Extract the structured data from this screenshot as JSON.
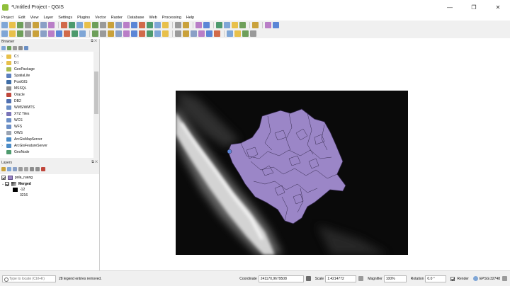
{
  "window": {
    "title": "*Untitled Project - QGIS",
    "controls": [
      "—",
      "❐",
      "✕"
    ]
  },
  "menu": [
    "Project",
    "Edit",
    "View",
    "Layer",
    "Settings",
    "Plugins",
    "Vector",
    "Raster",
    "Database",
    "Web",
    "Processing",
    "Help"
  ],
  "toolbar_icons": {
    "row1": [
      "new-project-icon",
      "open-project-icon",
      "save-project-icon",
      "save-as-icon",
      "print-layout-icon",
      "layout-manager-icon",
      "style-manager-icon",
      "sep",
      "pan-icon",
      "pan-to-selection-icon",
      "zoom-in-icon",
      "zoom-out-icon",
      "zoom-full-icon",
      "zoom-to-selection-icon",
      "zoom-to-layer-icon",
      "zoom-native-icon",
      "zoom-last-icon",
      "zoom-next-icon",
      "new-map-view-icon",
      "new-3d-view-icon",
      "temporal-icon",
      "refresh-icon",
      "sep",
      "identify-icon",
      "action-icon",
      "sep",
      "select-icon",
      "deselect-icon",
      "sep",
      "attribute-table-icon",
      "field-calculator-icon",
      "statistics-icon",
      "sum-icon",
      "sep",
      "measure-icon",
      "sep",
      "annotation-icon",
      "text-annotation-icon"
    ],
    "row2": [
      "data-source-manager-icon",
      "new-geopackage-icon",
      "new-shapefile-icon",
      "new-spatialite-icon",
      "new-memory-layer-icon",
      "add-vector-icon",
      "add-raster-icon",
      "add-mesh-icon",
      "add-delimited-text-icon",
      "add-spatialite-icon",
      "add-postgis-icon",
      "sep",
      "current-edits-icon",
      "toggle-editing-icon",
      "save-edits-icon",
      "digitize-icon",
      "delete-icon",
      "cut-icon",
      "copy-icon",
      "paste-icon",
      "undo-icon",
      "redo-icon",
      "sep",
      "label-icon",
      "label-pin-icon",
      "label-show-icon",
      "label-move-icon",
      "label-rotate-icon",
      "label-change-icon",
      "sep",
      "python-console-icon",
      "georeferencer-icon",
      "globe-icon",
      "plugin-icon"
    ]
  },
  "browser": {
    "title": "Browser",
    "items": [
      {
        "label": "C:\\",
        "icon": "folder-icon",
        "color": "#e8c04a",
        "arrow": "›"
      },
      {
        "label": "D:\\",
        "icon": "folder-icon",
        "color": "#e8c04a",
        "arrow": "›"
      },
      {
        "label": "GeoPackage",
        "icon": "geopackage-icon",
        "color": "#a9bc4f",
        "arrow": ""
      },
      {
        "label": "SpatiaLite",
        "icon": "spatialite-icon",
        "color": "#5b7fbf",
        "arrow": ""
      },
      {
        "label": "PostGIS",
        "icon": "postgis-icon",
        "color": "#3e6da6",
        "arrow": ""
      },
      {
        "label": "MSSQL",
        "icon": "mssql-icon",
        "color": "#8e8e8e",
        "arrow": ""
      },
      {
        "label": "Oracle",
        "icon": "oracle-icon",
        "color": "#c0463b",
        "arrow": ""
      },
      {
        "label": "DB2",
        "icon": "db2-icon",
        "color": "#4f6fb0",
        "arrow": ""
      },
      {
        "label": "WMS/WMTS",
        "icon": "wms-icon",
        "color": "#6b8fc7",
        "arrow": ""
      },
      {
        "label": "XYZ Tiles",
        "icon": "xyz-tiles-icon",
        "color": "#7a74b8",
        "arrow": "›"
      },
      {
        "label": "WCS",
        "icon": "wcs-icon",
        "color": "#6b8fc7",
        "arrow": ""
      },
      {
        "label": "WFS",
        "icon": "wfs-icon",
        "color": "#6b8fc7",
        "arrow": ""
      },
      {
        "label": "OWS",
        "icon": "ows-icon",
        "color": "#9aa4b3",
        "arrow": ""
      },
      {
        "label": "ArcGisMapServer",
        "icon": "arcgis-map-icon",
        "color": "#4a8bc7",
        "arrow": ""
      },
      {
        "label": "ArcGisFeatureServer",
        "icon": "arcgis-feature-icon",
        "color": "#4a8bc7",
        "arrow": "›"
      },
      {
        "label": "GeoNode",
        "icon": "geonode-icon",
        "color": "#4d9a6d",
        "arrow": ""
      }
    ]
  },
  "layers": {
    "title": "Layers",
    "items": [
      {
        "label": "pola_ruang",
        "type": "vector",
        "color": "#9b86c7",
        "checked": true
      },
      {
        "label": "Merged",
        "type": "raster",
        "color": "#5a5a5a",
        "checked": true
      }
    ],
    "legend": [
      {
        "label": "-12",
        "color": "#000000"
      },
      {
        "label": "3216",
        "color": "#ffffff"
      }
    ]
  },
  "map": {
    "polygon_fill": "#9b86c7",
    "polygon_stroke": "#2a2040",
    "raster_bg": "#0a0a0a"
  },
  "status": {
    "locator_placeholder": "Type to locate (Ctrl+K)",
    "message": "28 legend entries removed.",
    "coordinate_label": "Coordinate",
    "coordinate": "241170,9679508",
    "scale_label": "Scale",
    "scale": "1:4214772",
    "magnifier_label": "Magnifier",
    "magnifier": "100%",
    "rotation_label": "Rotation",
    "rotation": "0.0 °",
    "render_label": "Render",
    "crs": "EPSG:32748"
  }
}
